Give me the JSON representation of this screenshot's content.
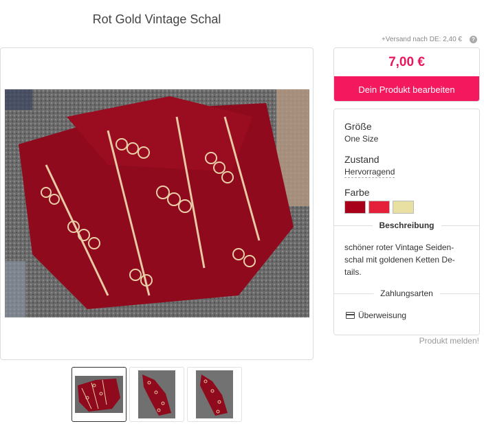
{
  "product": {
    "title": "Rot Gold Vintage Schal",
    "shipping": "+Versand nach DE: 2,40 €",
    "price": "7,00 €",
    "edit_button": "Dein Produkt bearbeiten",
    "report_link": "Produkt melden!"
  },
  "attributes": {
    "size_label": "Größe",
    "size_value": "One Size",
    "condition_label": "Zustand",
    "condition_value": "Hervorragend",
    "color_label": "Farbe",
    "colors": [
      "#a8001a",
      "#e5203a",
      "#e8dfa3"
    ]
  },
  "description": {
    "heading": "Beschreibung",
    "text": "schöner roter Vintage Seiden-schal mit goldenen Ketten De-tails."
  },
  "payment": {
    "heading": "Zahlungsarten",
    "method": "Überweisung",
    "icon": "credit-card-icon"
  },
  "icons": {
    "help": "help-icon"
  },
  "help_glyph": "?"
}
